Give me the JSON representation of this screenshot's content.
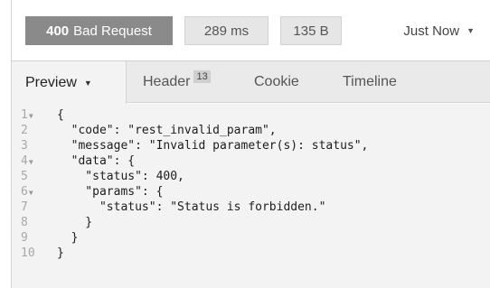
{
  "status": {
    "code": "400",
    "text": "Bad Request"
  },
  "time": "289 ms",
  "size": "135 B",
  "recent": {
    "label": "Just Now"
  },
  "tabs": {
    "preview": "Preview",
    "header": "Header",
    "header_count": "13",
    "cookie": "Cookie",
    "timeline": "Timeline"
  },
  "code_lines": [
    {
      "n": "1",
      "fold": true,
      "text": "{"
    },
    {
      "n": "2",
      "fold": false,
      "text": "  \"code\": \"rest_invalid_param\","
    },
    {
      "n": "3",
      "fold": false,
      "text": "  \"message\": \"Invalid parameter(s): status\","
    },
    {
      "n": "4",
      "fold": true,
      "text": "  \"data\": {"
    },
    {
      "n": "5",
      "fold": false,
      "text": "    \"status\": 400,"
    },
    {
      "n": "6",
      "fold": true,
      "text": "    \"params\": {"
    },
    {
      "n": "7",
      "fold": false,
      "text": "      \"status\": \"Status is forbidden.\""
    },
    {
      "n": "8",
      "fold": false,
      "text": "    }"
    },
    {
      "n": "9",
      "fold": false,
      "text": "  }"
    },
    {
      "n": "10",
      "fold": false,
      "text": "}"
    }
  ]
}
